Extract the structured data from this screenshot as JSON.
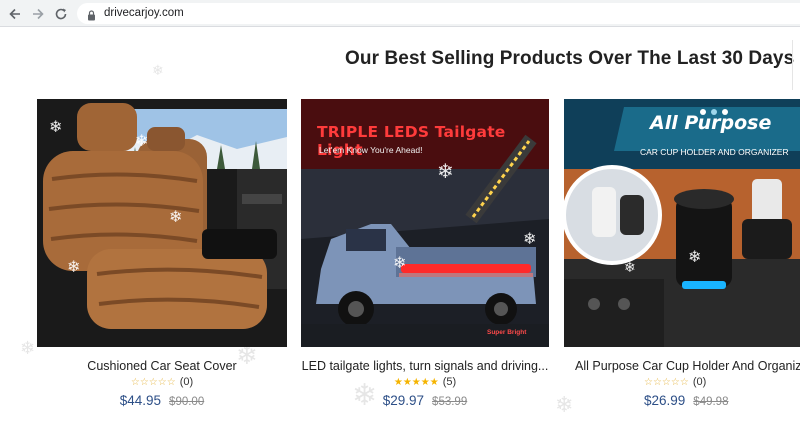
{
  "browser": {
    "url": "drivecarjoy.com",
    "icons": [
      "back-arrow-icon",
      "forward-arrow-icon",
      "reload-icon",
      "lock-icon"
    ]
  },
  "page": {
    "heading": "Our Best Selling Products Over The Last 30 Days"
  },
  "products": [
    {
      "title": "Cushioned Car Seat Cover",
      "rating_stars": "☆☆☆☆☆",
      "rating_value": 0,
      "rating_count": "(0)",
      "price": "$44.95",
      "old_price": "$90.00"
    },
    {
      "title": "LED tailgate lights, turn signals and driving...",
      "image_headline": "TRIPLE LEDS Tailgate Light",
      "image_tagline": "Let'em Know You're Ahead!",
      "image_badge": "Super Bright",
      "rating_stars": "★★★★★",
      "rating_value": 5,
      "rating_count": "(5)",
      "price": "$29.97",
      "old_price": "$53.99"
    },
    {
      "title": "All Purpose Car Cup Holder And Organizer",
      "image_headline": "All Purpose",
      "image_tagline": "CAR CUP HOLDER AND ORGANIZER",
      "rating_stars": "☆☆☆☆☆",
      "rating_value": 0,
      "rating_count": "(0)",
      "price": "$26.99",
      "old_price": "$49.98"
    }
  ],
  "colors": {
    "price": "#2d4f87",
    "star": "#f5b400",
    "chrome": "#f1f3f4"
  }
}
